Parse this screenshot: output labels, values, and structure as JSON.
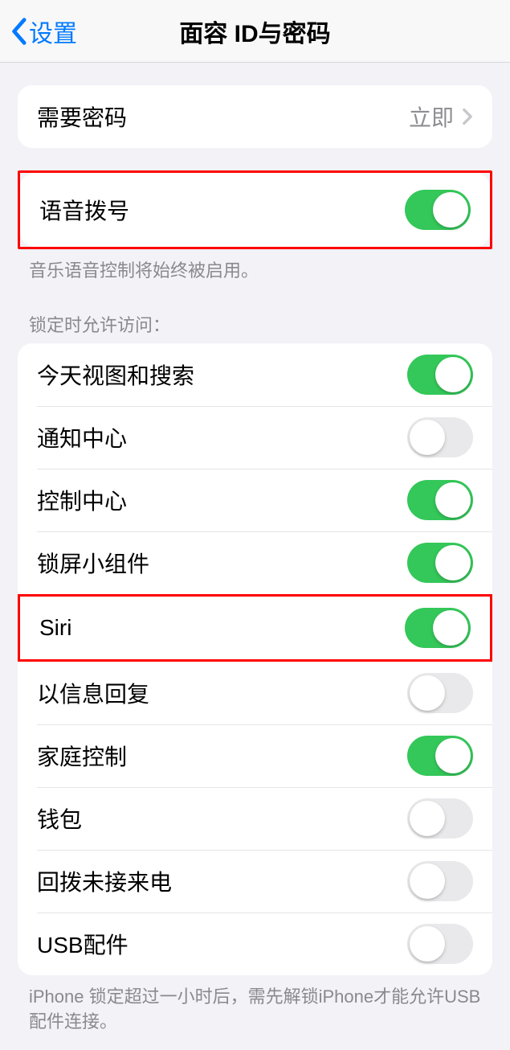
{
  "nav": {
    "back": "设置",
    "title": "面容 ID与密码"
  },
  "require_passcode": {
    "label": "需要密码",
    "value": "立即"
  },
  "voice_dial": {
    "label": "语音拨号",
    "on": true,
    "footer": "音乐语音控制将始终被启用。"
  },
  "lock_access": {
    "header": "锁定时允许访问：",
    "items": [
      {
        "label": "今天视图和搜索",
        "on": true
      },
      {
        "label": "通知中心",
        "on": false
      },
      {
        "label": "控制中心",
        "on": true
      },
      {
        "label": "锁屏小组件",
        "on": true
      },
      {
        "label": "Siri",
        "on": true
      },
      {
        "label": "以信息回复",
        "on": false
      },
      {
        "label": "家庭控制",
        "on": true
      },
      {
        "label": "钱包",
        "on": false
      },
      {
        "label": "回拨未接来电",
        "on": false
      },
      {
        "label": "USB配件",
        "on": false
      }
    ],
    "footer": "iPhone 锁定超过一小时后，需先解锁iPhone才能允许USB 配件连接。"
  },
  "highlighted_indices": [
    4
  ]
}
